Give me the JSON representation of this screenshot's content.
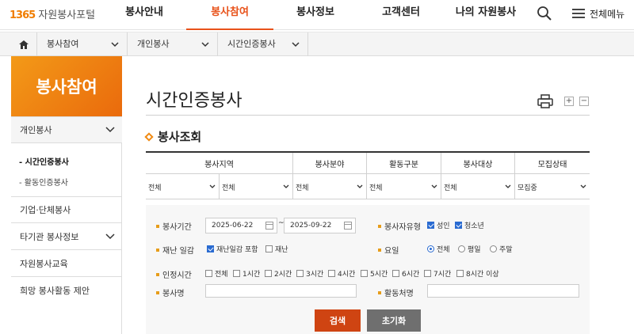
{
  "header": {
    "logo_num": "1365",
    "logo_word": "자원봉사포털",
    "nav": [
      {
        "label": "봉사안내",
        "active": false
      },
      {
        "label": "봉사참여",
        "active": true
      },
      {
        "label": "봉사정보",
        "active": false
      },
      {
        "label": "고객센터",
        "active": false
      },
      {
        "label": "나의 자원봉사",
        "active": false
      }
    ],
    "all_menu": "전체메뉴",
    "icons": [
      "search-icon",
      "hamburger-icon"
    ]
  },
  "breadcrumb": {
    "items": [
      "봉사참여",
      "개인봉사",
      "시간인증봉사"
    ]
  },
  "sidebar": {
    "title": "봉사참여",
    "items": [
      {
        "label": "개인봉사",
        "expanded": true,
        "sub": [
          {
            "label": "시간인증봉사",
            "current": true
          },
          {
            "label": "활동인증봉사",
            "current": false
          }
        ]
      },
      {
        "label": "기업·단체봉사"
      },
      {
        "label": "타기관 봉사정보"
      },
      {
        "label": "자원봉사교육"
      },
      {
        "label": "희망 봉사활동 제안"
      }
    ]
  },
  "main": {
    "title": "시간인증봉사",
    "font_plus": "+",
    "font_minus": "−",
    "section_title": "봉사조회",
    "filter_headers": [
      "봉사지역",
      "봉사분야",
      "활동구분",
      "봉사대상",
      "모집상태"
    ],
    "filter_values": [
      "전체",
      "전체",
      "전체",
      "전체",
      "전체",
      "모집중"
    ],
    "search": {
      "period_label": "봉사기간",
      "date_from": "2025-06-22",
      "date_sep": "~",
      "date_to": "2025-09-22",
      "vol_type_label": "봉사자유형",
      "vol_types": [
        {
          "label": "성인",
          "checked": true
        },
        {
          "label": "청소년",
          "checked": true
        }
      ],
      "disaster_label": "재난 일감",
      "disaster_opts": [
        {
          "label": "재난일감 포함",
          "checked": true
        },
        {
          "label": "재난",
          "checked": false
        }
      ],
      "day_label": "요일",
      "day_opts": [
        {
          "label": "전체",
          "checked": true
        },
        {
          "label": "평일",
          "checked": false
        },
        {
          "label": "주말",
          "checked": false
        }
      ],
      "hours_label": "인정시간",
      "hours_opts": [
        "전체",
        "1시간",
        "2시간",
        "3시간",
        "4시간",
        "5시간",
        "6시간",
        "7시간",
        "8시간 이상"
      ],
      "name_label": "봉사명",
      "place_label": "활동처명"
    },
    "search_button": "검색",
    "reset_button": "초기화"
  },
  "colors": {
    "accent": "#e8521a",
    "sidebar_gradient_start": "#f39a18",
    "sidebar_gradient_end": "#ea6a0c",
    "search_button": "#cf4412",
    "reset_button": "#6f6f6f",
    "checkbox": "#2a6bd1"
  }
}
